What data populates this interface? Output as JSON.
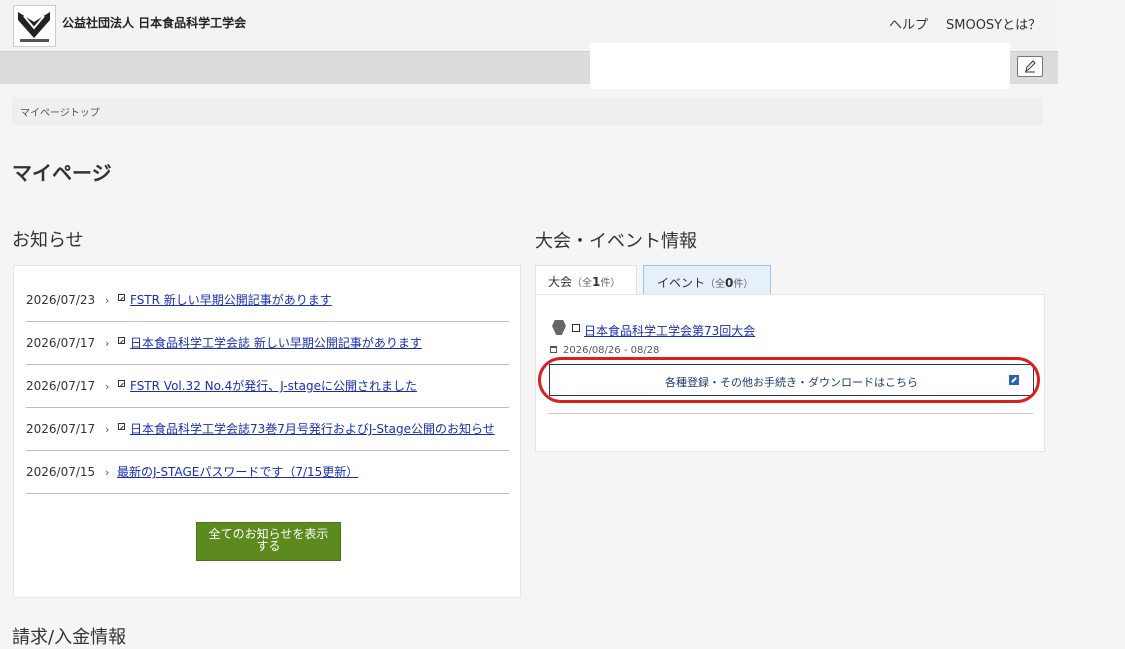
{
  "header": {
    "org_name": "公益社団法人 日本食品科学工学会",
    "nav": {
      "help": "ヘルプ",
      "about": "SMOOSYとは？"
    }
  },
  "breadcrumb": {
    "item": "マイページトップ"
  },
  "page_title": "マイページ",
  "news": {
    "title": "お知らせ",
    "items": [
      {
        "date": "2026/07/23",
        "label": "FSTR 新しい早期公開記事があります",
        "has_icon": true
      },
      {
        "date": "2026/07/17",
        "label": "日本食品科学工学会誌 新しい早期公開記事があります",
        "has_icon": true
      },
      {
        "date": "2026/07/17",
        "label": "FSTR Vol.32 No.4が発行、J-stageに公開されました",
        "has_icon": true
      },
      {
        "date": "2026/07/17",
        "label": "日本食品科学工学会誌73巻7月号発行およびJ-Stage公開のお知らせ",
        "has_icon": true
      },
      {
        "date": "2026/07/15",
        "label": "最新のJ-STAGEパスワードです（7/15更新）",
        "has_icon": false
      }
    ],
    "arrow": "›",
    "show_all_label": "全てのお知らせを表示する"
  },
  "events": {
    "title": "大会・イベント情報",
    "tabs": [
      {
        "name": "大会",
        "prefix": "（全",
        "count": "1",
        "suffix": "件）"
      },
      {
        "name": "イベント",
        "prefix": "（全",
        "count": "0",
        "suffix": "件）"
      }
    ],
    "item": {
      "title": "日本食品科学工学会第73回大会",
      "date": "2026/08/26 - 08/28",
      "register_label": "各種登録・その他お手続き・ダウンロードはこちら"
    }
  },
  "bottom_heading": "請求/入金情報",
  "colors": {
    "accent_green": "#5d8a1f",
    "link_blue": "#1a2fb0",
    "highlight_red": "#d8201c",
    "tab_active_bg": "#e6f0fa"
  },
  "icons": [
    "logo",
    "edit-icon",
    "external-link-icon",
    "calendar-icon",
    "event-logo-icon"
  ]
}
